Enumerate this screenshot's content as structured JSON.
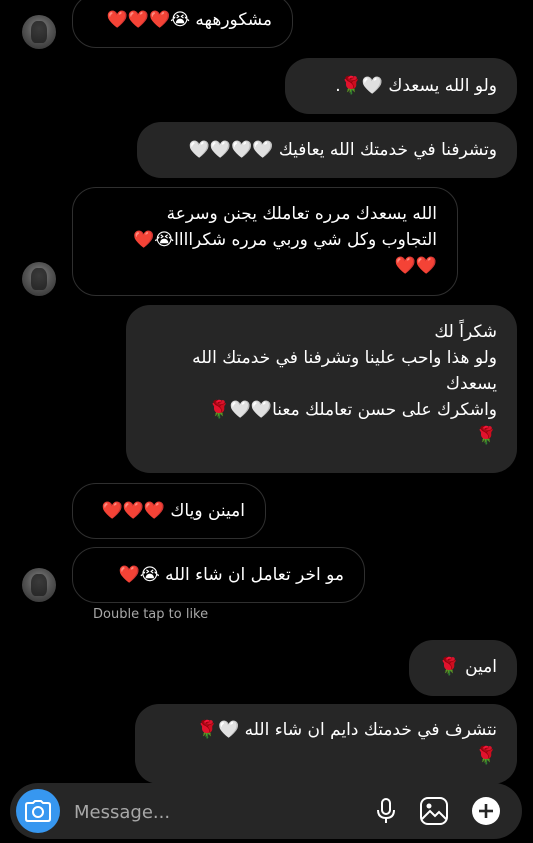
{
  "messages": [
    {
      "side": "in",
      "lines": [
        "مشكورههه 😭❤️❤️❤️"
      ]
    },
    {
      "side": "out",
      "lines": [
        "ولو الله يسعدك 🤍🌹."
      ]
    },
    {
      "side": "out",
      "lines": [
        "وتشرفنا في خدمتك الله يعافيك 🤍🤍🤍🤍"
      ]
    },
    {
      "side": "in",
      "lines": [
        "الله يسعدك مرره تعاملك يجنن وسرعة",
        "التجاوب وكل شي وربي مرره شكراااا😭❤️",
        "❤️❤️"
      ]
    },
    {
      "side": "out",
      "lines": [
        "شكراً لك",
        "ولو هذا واحب علينا وتشرفنا في خدمتك الله",
        "يسعدك",
        "واشكرك على حسن تعاملك معنا🤍🤍🌹",
        "🌹"
      ]
    },
    {
      "side": "in",
      "lines": [
        "امينن وياك ❤️❤️❤️"
      ]
    },
    {
      "side": "in",
      "lines": [
        "مو اخر تعامل ان شاء الله 😭❤️"
      ]
    },
    {
      "side": "out",
      "lines": [
        "امين 🌹"
      ]
    },
    {
      "side": "out",
      "lines": [
        "نتشرف في خدمتك دايم ان شاء الله 🤍🌹",
        "🌹"
      ]
    }
  ],
  "double_tap_hint": "Double tap to like",
  "composer": {
    "placeholder": "Message...",
    "camera_icon": "camera-icon",
    "mic_icon": "microphone-icon",
    "gallery_icon": "image-gallery-icon",
    "add_icon": "add-circle-icon"
  },
  "colors": {
    "background": "#000000",
    "incoming_bubble_border": "#2f2f2f",
    "outgoing_bubble": "#262626",
    "camera_button": "#3797f0",
    "hint_text": "#a8a8a8"
  }
}
